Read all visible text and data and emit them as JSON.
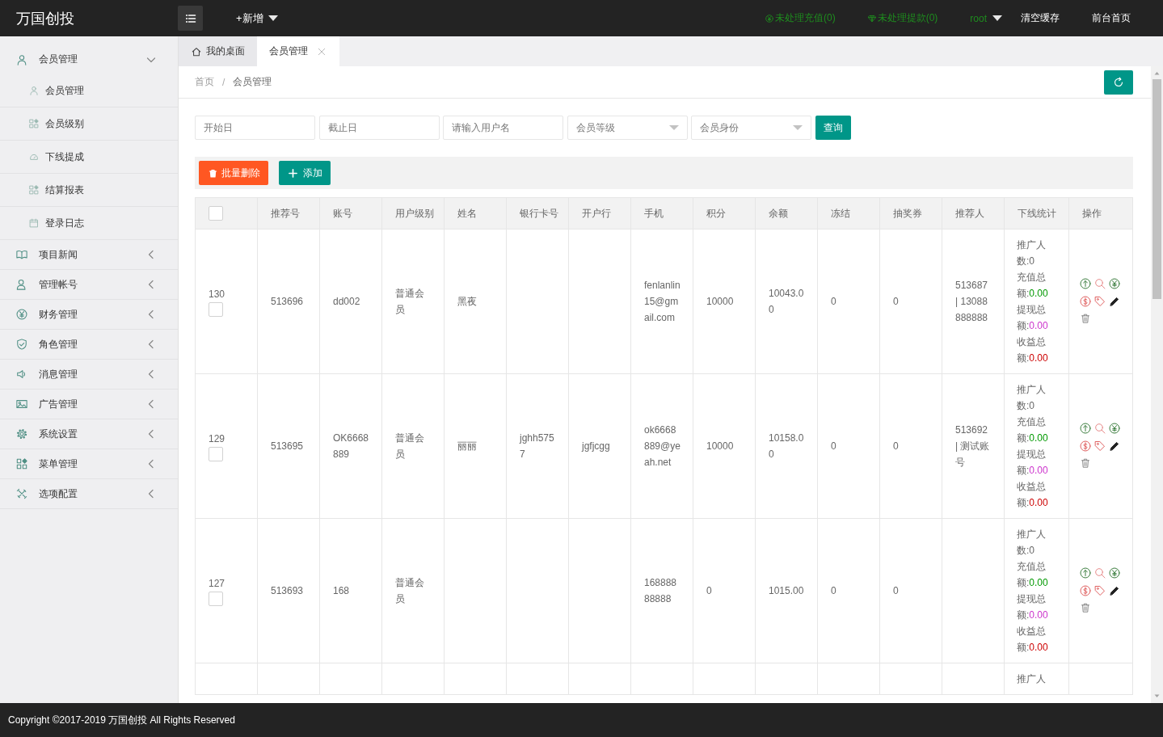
{
  "header": {
    "logo": "万国创投",
    "add_menu": "+新增",
    "links": [
      {
        "kind": "notice",
        "label": "未处理充值(0)"
      },
      {
        "kind": "notice",
        "label": "未处理提款(0)"
      },
      {
        "kind": "user",
        "label": "root"
      },
      {
        "kind": "link",
        "label": "清空缓存"
      },
      {
        "kind": "link",
        "label": "前台首页"
      }
    ]
  },
  "sidebar": {
    "items": [
      {
        "label": "会员管理",
        "expanded": true,
        "children": [
          {
            "label": "会员管理"
          },
          {
            "label": "会员级别"
          },
          {
            "label": "下线提成"
          },
          {
            "label": "结算报表"
          },
          {
            "label": "登录日志"
          }
        ]
      },
      {
        "label": "项目新闻",
        "expanded": false
      },
      {
        "label": "管理帐号",
        "expanded": false
      },
      {
        "label": "财务管理",
        "expanded": false
      },
      {
        "label": "角色管理",
        "expanded": false
      },
      {
        "label": "消息管理",
        "expanded": false
      },
      {
        "label": "广告管理",
        "expanded": false
      },
      {
        "label": "系统设置",
        "expanded": false
      },
      {
        "label": "菜单管理",
        "expanded": false
      },
      {
        "label": "选项配置",
        "expanded": false
      }
    ]
  },
  "tabs": [
    {
      "kind": "home",
      "label": "我的桌面",
      "selected": false
    },
    {
      "kind": "page",
      "label": "会员管理",
      "selected": true
    }
  ],
  "breadcrumb": {
    "items": [
      "首页",
      "会员管理"
    ],
    "separator": "/"
  },
  "filters": {
    "fields": [
      {
        "kind": "input",
        "placeholder": "开始日"
      },
      {
        "kind": "input",
        "placeholder": "截止日"
      },
      {
        "kind": "input",
        "placeholder": "请输入用户名"
      },
      {
        "kind": "select",
        "placeholder": "会员等级"
      },
      {
        "kind": "select",
        "placeholder": "会员身份"
      }
    ],
    "search_button": "查询"
  },
  "toolbar": {
    "buttons": [
      {
        "kind": "delete",
        "label": "批量删除"
      },
      {
        "kind": "add",
        "label": "添加"
      }
    ]
  },
  "table": {
    "select_all": {
      "checked": false
    },
    "columns": [
      "推荐号",
      "账号",
      "用户级别",
      "姓名",
      "银行卡号",
      "开户行",
      "手机",
      "积分",
      "余额",
      "冻结",
      "抽奖券",
      "推荐人",
      "下线统计",
      "操作"
    ],
    "rows": [
      {
        "id": "130",
        "checked": false,
        "cells": [
          "513696",
          "dd002",
          "普通会员",
          "黑夜",
          null,
          null,
          "fenlanlin15@gmail.com",
          "10000",
          "10043.00",
          "0",
          "0",
          "513687 | 13088888888"
        ],
        "stats": [
          {
            "label": "推广人数:",
            "value": "0",
            "color": "#666666"
          },
          {
            "label": "充值总额:",
            "value": "0.00",
            "color": "#009900"
          },
          {
            "label": "提现总额:",
            "value": "0.00",
            "color": "#cc33cc"
          },
          {
            "label": "收益总额:",
            "value": "0.00",
            "color": "#cc0000"
          }
        ],
        "actions": true
      },
      {
        "id": "129",
        "checked": false,
        "cells": [
          "513695",
          "OK6668889",
          "普通会员",
          "丽丽",
          "jghh5757",
          "jgfjcgg",
          "ok6668889@yeah.net",
          "10000",
          "10158.00",
          "0",
          "0",
          "513692 | 测试账号"
        ],
        "stats": [
          {
            "label": "推广人数:",
            "value": "0",
            "color": "#666666"
          },
          {
            "label": "充值总额:",
            "value": "0.00",
            "color": "#009900"
          },
          {
            "label": "提现总额:",
            "value": "0.00",
            "color": "#cc33cc"
          },
          {
            "label": "收益总额:",
            "value": "0.00",
            "color": "#cc0000"
          }
        ],
        "actions": true
      },
      {
        "id": "127",
        "checked": false,
        "cells": [
          "513693",
          "168",
          "普通会员",
          null,
          null,
          null,
          "16888888888",
          "0",
          "1015.00",
          "0",
          "0",
          null
        ],
        "stats": [
          {
            "label": "推广人数:",
            "value": "0",
            "color": "#666666"
          },
          {
            "label": "充值总额:",
            "value": "0.00",
            "color": "#009900"
          },
          {
            "label": "提现总额:",
            "value": "0.00",
            "color": "#cc33cc"
          },
          {
            "label": "收益总额:",
            "value": "0.00",
            "color": "#cc0000"
          }
        ],
        "actions": true
      },
      {
        "stats": [
          {
            "label": "推广人"
          }
        ]
      }
    ]
  },
  "footer": {
    "copyright": "Copyright ©2017-2019 万国创投 All Rights Reserved"
  }
}
